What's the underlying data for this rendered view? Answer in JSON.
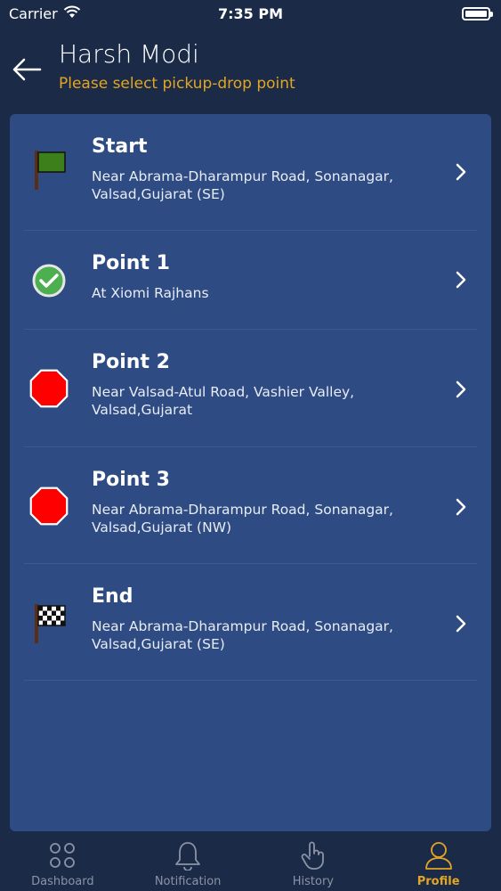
{
  "status_bar": {
    "carrier": "Carrier",
    "time": "7:35 PM"
  },
  "header": {
    "title": "Harsh Modi",
    "subtitle": "Please select pickup-drop point"
  },
  "points": [
    {
      "title": "Start",
      "subtitle": "Near Abrama-Dharampur Road, Sonanagar, Valsad,Gujarat (SE)",
      "icon": "green-flag-icon"
    },
    {
      "title": "Point 1",
      "subtitle": "At Xiomi Rajhans",
      "icon": "green-check-icon"
    },
    {
      "title": "Point 2",
      "subtitle": "Near Valsad-Atul Road, Vashier Valley, Valsad,Gujarat",
      "icon": "stop-octagon-icon"
    },
    {
      "title": "Point 3",
      "subtitle": "Near Abrama-Dharampur Road, Sonanagar, Valsad,Gujarat (NW)",
      "icon": "stop-octagon-icon"
    },
    {
      "title": "End",
      "subtitle": "Near Abrama-Dharampur Road, Sonanagar, Valsad,Gujarat (SE)",
      "icon": "checkered-flag-icon"
    }
  ],
  "tabs": [
    {
      "label": "Dashboard",
      "icon": "dashboard-icon",
      "active": false
    },
    {
      "label": "Notification",
      "icon": "bell-icon",
      "active": false
    },
    {
      "label": "History",
      "icon": "hand-icon",
      "active": false
    },
    {
      "label": "Profile",
      "icon": "profile-icon",
      "active": true
    }
  ],
  "colors": {
    "background": "#1b2a47",
    "card": "#2e4c83",
    "accent": "#e2a623",
    "stop_red": "#ff0000",
    "check_green": "#4caf50"
  }
}
